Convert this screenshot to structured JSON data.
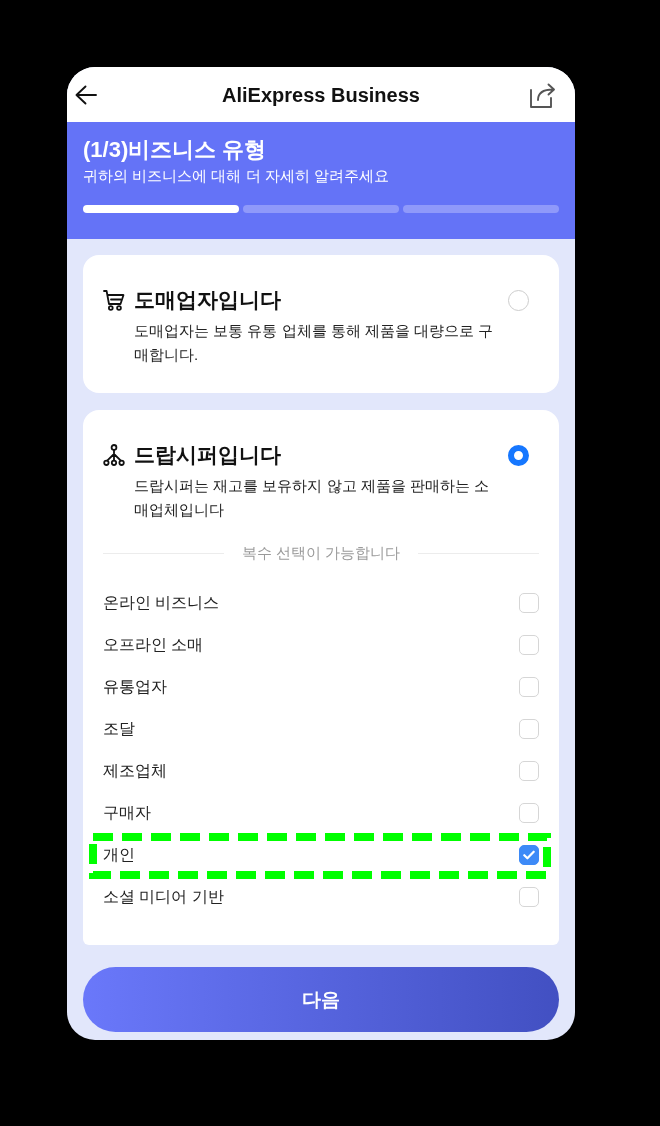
{
  "header": {
    "title": "AliExpress Business"
  },
  "banner": {
    "title": "(1/3)비즈니스 유형",
    "subtitle": "귀하의 비즈니스에 대해 더 자세히 알려주세요",
    "steps": [
      {
        "completed": true
      },
      {
        "completed": false
      },
      {
        "completed": false
      }
    ]
  },
  "cards": [
    {
      "kind": "wholesale",
      "title": "도매업자입니다",
      "description": "도매업자는 보통 유통 업체를 통해 제품을 대량으로 구매합니다.",
      "selected": false
    },
    {
      "kind": "dropship",
      "title": "드랍시퍼입니다",
      "description": "드랍시퍼는 재고를 보유하지 않고 제품을 판매하는 소매업체입니다",
      "selected": true,
      "options_hint": "복수 선택이 가능합니다",
      "options": [
        {
          "label": "온라인 비즈니스",
          "checked": false,
          "highlighted": false
        },
        {
          "label": "오프라인 소매",
          "checked": false,
          "highlighted": false
        },
        {
          "label": "유통업자",
          "checked": false,
          "highlighted": false
        },
        {
          "label": "조달",
          "checked": false,
          "highlighted": false
        },
        {
          "label": "제조업체",
          "checked": false,
          "highlighted": false
        },
        {
          "label": "구매자",
          "checked": false,
          "highlighted": false
        },
        {
          "label": "개인",
          "checked": true,
          "highlighted": true
        },
        {
          "label": "소셜 미디어 기반",
          "checked": false,
          "highlighted": false
        }
      ]
    }
  ],
  "next_button": {
    "label": "다음"
  }
}
